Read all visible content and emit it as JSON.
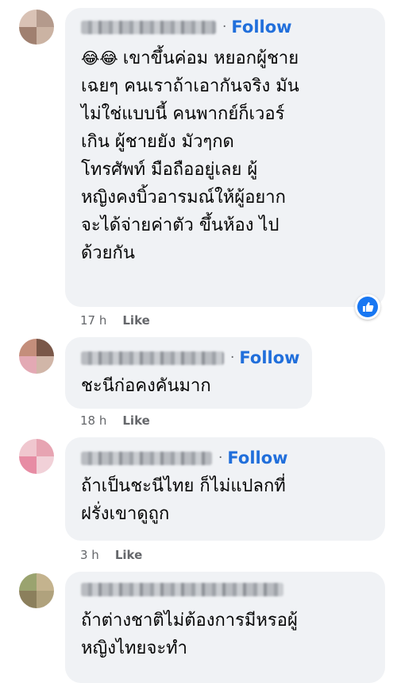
{
  "comments": [
    {
      "name_redacted": true,
      "follow_label": "Follow",
      "emoji": "😂😂",
      "text": "เขาขึ้นค่อม หยอกผู้ชายเฉยๆ คนเราถ้าเอากันจริง มันไม่ใช่แบบนี้ คนพากย์ก็เวอร์เกิน ผู้ชายยัง มัวๆกดโทรศัพท์ มือถืออยู่เลย ผู้หญิงคงบิ้วอารมณ์ให้ผู้อยากจะได้จ่ายค่าตัว ขึ้นห้อง ไปด้วยกัน",
      "lines": [
        "เขาขึ้นค่อม หยอกผู้ชาย",
        "เฉยๆ คนเราถ้าเอากันจริง มัน",
        "ไม่ใช่แบบนี้ คนพากย์ก็เวอร์",
        "เกิน ผู้ชายยัง มัวๆกด",
        "โทรศัพท์ มือถืออยู่เลย ผู้",
        "หญิงคงบิ้วอารมณ์ให้ผู้อยาก",
        "จะได้จ่ายค่าตัว ขึ้นห้อง ไป",
        "ด้วยกัน"
      ],
      "time": "17 h",
      "like_label": "Like",
      "reaction": "like-reaction-icon"
    },
    {
      "name_redacted": true,
      "follow_label": "Follow",
      "text": "ชะนีก่อคงคันมาก",
      "time": "18 h",
      "like_label": "Like"
    },
    {
      "name_redacted": true,
      "follow_label": "Follow",
      "lines": [
        "ถ้าเป็นชะนีไทย ก็ไม่แปลกที่",
        "ฝรั่งเขาดูถูก"
      ],
      "time": "3 h",
      "like_label": "Like"
    },
    {
      "name_redacted": true,
      "lines": [
        "ถ้าต่างชาติไม่ต้องการมีหรอผู้",
        "หญิงไทยจะทำ"
      ]
    }
  ],
  "colors": {
    "bubble": "#f0f2f5",
    "follow": "#216fdb",
    "meta": "#65676b",
    "text": "#050505",
    "like_badge": "#1877f2"
  }
}
